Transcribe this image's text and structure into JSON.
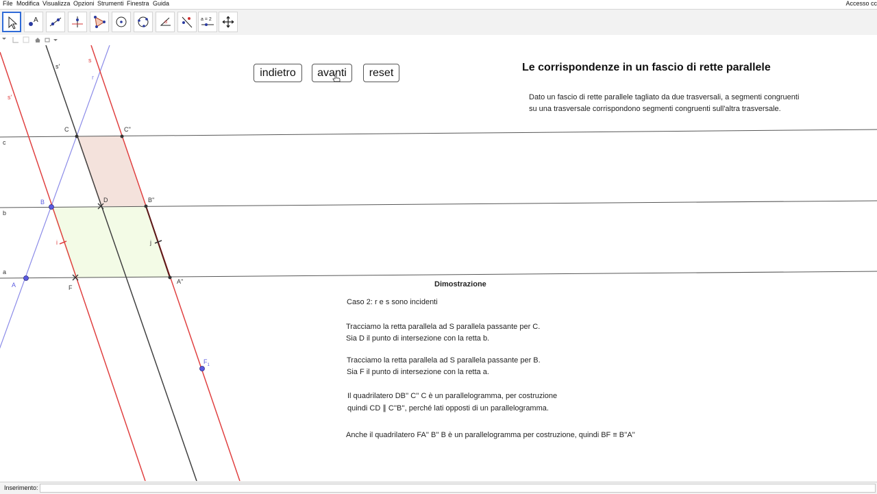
{
  "menubar": {
    "items": [
      "File",
      "Modifica",
      "Visualizza",
      "Opzioni",
      "Strumenti",
      "Finestra",
      "Guida"
    ],
    "account": "Accesso cc"
  },
  "toolbar": {
    "tools": [
      "move-tool-icon",
      "point-tool-icon",
      "line-tool-icon",
      "perpendicular-tool-icon",
      "polygon-tool-icon",
      "circle-tool-icon",
      "conic-tool-icon",
      "angle-tool-icon",
      "reflect-tool-icon",
      "slider-tool-icon",
      "move-view-tool-icon"
    ],
    "slider_label": "a = 2"
  },
  "buttons": {
    "back": "indietro",
    "next": "avanti",
    "reset": "reset"
  },
  "title": "Le corrispondenze in un fascio di rette parallele",
  "intro": {
    "line1": "Dato un fascio di rette parallele tagliato da due trasversali, a segmenti congruenti",
    "line2": "su una trasversale corrispondono segmenti congruenti sull'altra trasversale."
  },
  "proof": {
    "heading": "Dimostrazione",
    "case": "Caso 2: r e s sono incidenti",
    "p1a": "Tracciamo la retta parallela ad S parallela passante per C.",
    "p1b": "Sia D il punto di intersezione con la retta b.",
    "p2a": "Tracciamo la retta parallela ad S parallela passante per B.",
    "p2b": "Sia F il punto di intersezione con la retta a.",
    "p3a": "Il quadrilatero DB'' C'' C è un parallelogramma, per costruzione",
    "p3b": "quindi CD ∥ C''B'', perché lati opposti di un parallelogramma.",
    "p4": "Anche il quadrilatero FA'' B'' B è un parallelogramma per costruzione, quindi BF ≡ B''A''"
  },
  "labels": {
    "s_prime_top": "s'",
    "s_top": "s",
    "r_top": "r",
    "s_prime_left": "s'",
    "c_line": "c",
    "b_line": "b",
    "a_line": "a",
    "C": "C",
    "C2": "C''",
    "B": "B",
    "D": "D",
    "B2": "B''",
    "i": "i",
    "j": "j",
    "A": "A",
    "F": "F",
    "A2": "A''",
    "F1": "F",
    "F1_sub": "1"
  },
  "colors": {
    "red": "#e04040",
    "blue": "#8a8ae8",
    "dark": "#404040",
    "accent": "#2f6bd8"
  },
  "inputbar": {
    "label": "Inserimento:",
    "value": ""
  }
}
